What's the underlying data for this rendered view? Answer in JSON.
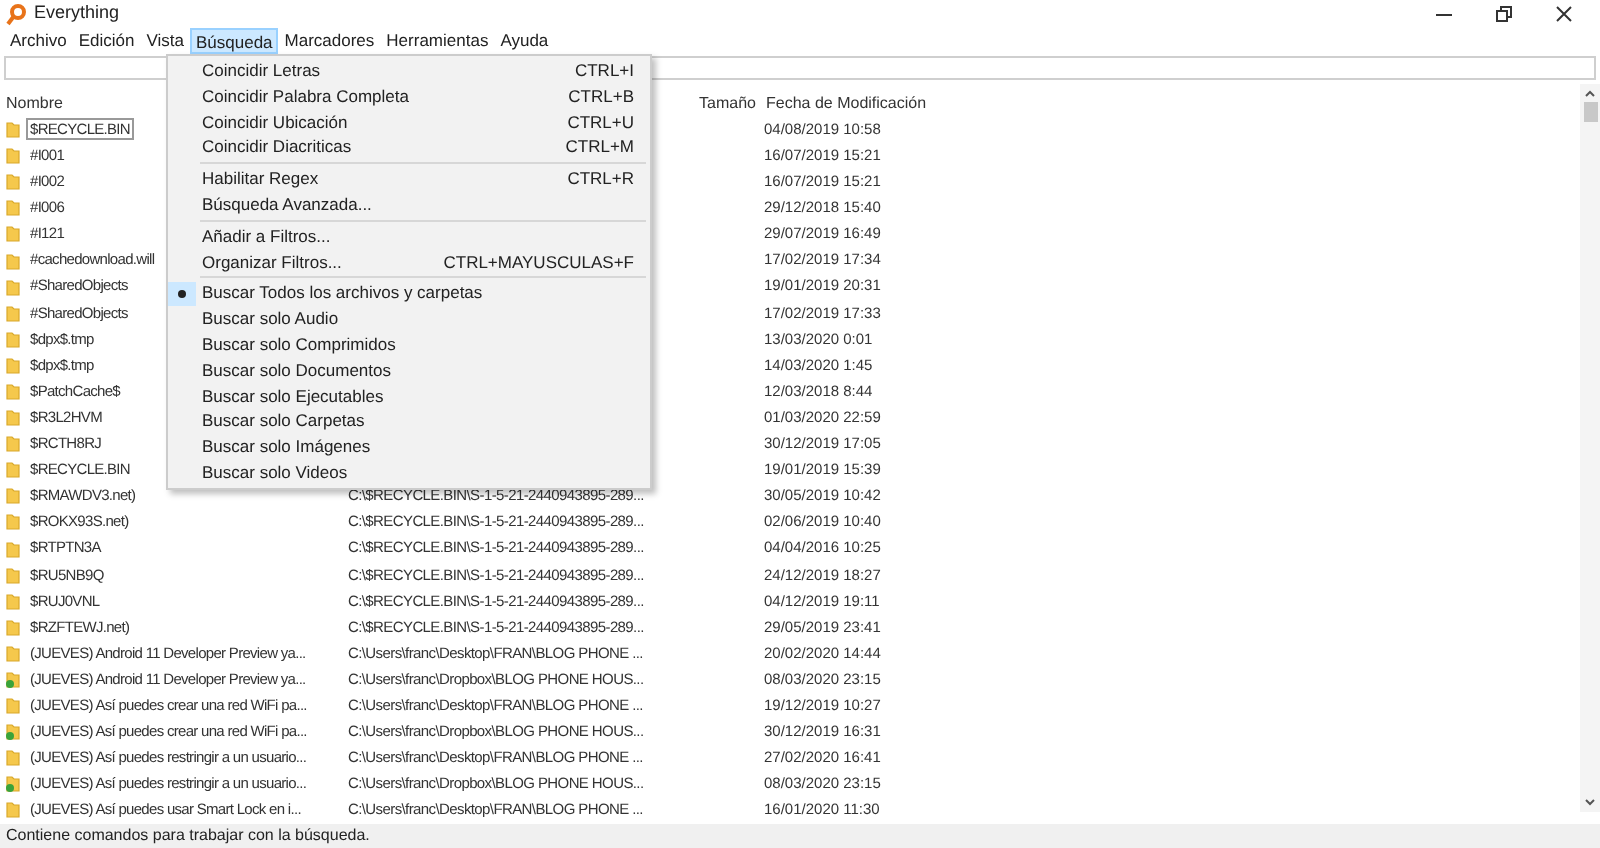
{
  "window": {
    "title": "Everything"
  },
  "menu_bar": [
    {
      "label": "Archivo",
      "selected": false
    },
    {
      "label": "Edición",
      "selected": false
    },
    {
      "label": "Vista",
      "selected": false
    },
    {
      "label": "Búsqueda",
      "selected": true
    },
    {
      "label": "Marcadores",
      "selected": false
    },
    {
      "label": "Herramientas",
      "selected": false
    },
    {
      "label": "Ayuda",
      "selected": false
    }
  ],
  "columns": [
    "Nombre",
    "Tamaño",
    "Fecha de Modificación"
  ],
  "rows": [
    {
      "kind": "folder",
      "name": "$RECYCLE.BIN",
      "date": "04/08/2019 10:58",
      "selected": true
    },
    {
      "kind": "folder",
      "name": "#I001",
      "date": "16/07/2019 15:21",
      "selected": false
    },
    {
      "kind": "folder",
      "name": "#I002",
      "date": "16/07/2019 15:21",
      "selected": false
    },
    {
      "kind": "folder",
      "name": "#I006",
      "date": "29/12/2018 15:40",
      "selected": false
    },
    {
      "kind": "folder",
      "name": "#I121",
      "date": "29/07/2019 16:49",
      "selected": false
    },
    {
      "kind": "folder",
      "name": "#cachedownload.will",
      "date": "17/02/2019 17:34",
      "selected": false
    },
    {
      "kind": "folder",
      "name": "#SharedObjects",
      "date": "19/01/2019 20:31",
      "selected": false
    },
    {
      "kind": "folder",
      "name": "#SharedObjects",
      "date": "17/02/2019 17:33",
      "selected": false
    },
    {
      "kind": "folder",
      "name": "$dpx$.tmp",
      "date": "13/03/2020 0:01",
      "selected": false
    },
    {
      "kind": "folder",
      "name": "$dpx$.tmp",
      "date": "14/03/2020 1:45",
      "selected": false
    },
    {
      "kind": "folder",
      "name": "$PatchCache$",
      "date": "12/03/2018 8:44",
      "selected": false
    },
    {
      "kind": "folder",
      "name": "$R3L2HVM",
      "date": "01/03/2020 22:59",
      "selected": false
    },
    {
      "kind": "folder",
      "name": "$RCTH8RJ",
      "date": "30/12/2019 17:05",
      "selected": false
    },
    {
      "kind": "folder",
      "name": "$RECYCLE.BIN",
      "date": "19/01/2019 15:39",
      "selected": false
    },
    {
      "kind": "folder",
      "name": "$RMAWDV3.net)",
      "path": "C:\\$RECYCLE.BIN\\S-1-5-21-2440943895-289...",
      "date": "30/05/2019 10:42",
      "selected": false
    },
    {
      "kind": "folder",
      "name": "$ROKX93S.net)",
      "path": "C:\\$RECYCLE.BIN\\S-1-5-21-2440943895-289...",
      "date": "02/06/2019 10:40",
      "selected": false
    },
    {
      "kind": "folder",
      "name": "$RTPTN3A",
      "path": "C:\\$RECYCLE.BIN\\S-1-5-21-2440943895-289...",
      "date": "04/04/2016 10:25",
      "selected": false
    },
    {
      "kind": "folder",
      "name": "$RU5NB9Q",
      "path": "C:\\$RECYCLE.BIN\\S-1-5-21-2440943895-289...",
      "date": "24/12/2019 18:27",
      "selected": false
    },
    {
      "kind": "folder",
      "name": "$RUJ0VNL",
      "path": "C:\\$RECYCLE.BIN\\S-1-5-21-2440943895-289...",
      "date": "04/12/2019 19:11",
      "selected": false
    },
    {
      "kind": "folder",
      "name": "$RZFTEWJ.net)",
      "path": "C:\\$RECYCLE.BIN\\S-1-5-21-2440943895-289...",
      "date": "29/05/2019 23:41",
      "selected": false
    },
    {
      "kind": "folder",
      "name": "(JUEVES) Android 11 Developer Preview ya...",
      "path": "C:\\Users\\franc\\Desktop\\FRAN\\BLOG PHONE ...",
      "date": "20/02/2020 14:44",
      "selected": false
    },
    {
      "kind": "synced",
      "name": "(JUEVES) Android 11 Developer Preview ya...",
      "path": "C:\\Users\\franc\\Dropbox\\BLOG PHONE HOUS...",
      "date": "08/03/2020 23:15",
      "selected": false
    },
    {
      "kind": "folder",
      "name": "(JUEVES) Así puedes crear una red WiFi pa...",
      "path": "C:\\Users\\franc\\Desktop\\FRAN\\BLOG PHONE ...",
      "date": "19/12/2019 10:27",
      "selected": false
    },
    {
      "kind": "synced",
      "name": "(JUEVES) Así puedes crear una red WiFi pa...",
      "path": "C:\\Users\\franc\\Dropbox\\BLOG PHONE HOUS...",
      "date": "30/12/2019 16:31",
      "selected": false
    },
    {
      "kind": "folder",
      "name": "(JUEVES) Así puedes restringir a un usuario...",
      "path": "C:\\Users\\franc\\Desktop\\FRAN\\BLOG PHONE ...",
      "date": "27/02/2020 16:41",
      "selected": false
    },
    {
      "kind": "synced",
      "name": "(JUEVES) Así puedes restringir a un usuario...",
      "path": "C:\\Users\\franc\\Dropbox\\BLOG PHONE HOUS...",
      "date": "08/03/2020 23:15",
      "selected": false
    },
    {
      "kind": "folder",
      "name": "(JUEVES) Así puedes usar Smart Lock en i...",
      "path": "C:\\Users\\franc\\Desktop\\FRAN\\BLOG PHONE ...",
      "date": "16/01/2020 11:30",
      "selected": false
    }
  ],
  "search_menu": [
    {
      "kind": "item",
      "label": "Coincidir Letras",
      "shortcut": "CTRL+I"
    },
    {
      "kind": "item",
      "label": "Coincidir Palabra Completa",
      "shortcut": "CTRL+B"
    },
    {
      "kind": "item",
      "label": "Coincidir Ubicación",
      "shortcut": "CTRL+U"
    },
    {
      "kind": "item",
      "label": "Coincidir Diacriticas",
      "shortcut": "CTRL+M"
    },
    {
      "kind": "separator"
    },
    {
      "kind": "item",
      "label": "Habilitar Regex",
      "shortcut": "CTRL+R"
    },
    {
      "kind": "item",
      "label": "Búsqueda Avanzada..."
    },
    {
      "kind": "separator"
    },
    {
      "kind": "item",
      "label": "Añadir a Filtros..."
    },
    {
      "kind": "item",
      "label": "Organizar Filtros...",
      "shortcut": "CTRL+MAYUSCULAS+F"
    },
    {
      "kind": "separator"
    },
    {
      "kind": "radio",
      "label": "Buscar Todos los archivos y carpetas",
      "selected": true
    },
    {
      "kind": "radio",
      "label": "Buscar solo Audio",
      "selected": false
    },
    {
      "kind": "radio",
      "label": "Buscar solo Comprimidos",
      "selected": false
    },
    {
      "kind": "radio",
      "label": "Buscar solo Documentos",
      "selected": false
    },
    {
      "kind": "radio",
      "label": "Buscar solo Ejecutables",
      "selected": false
    },
    {
      "kind": "radio",
      "label": "Buscar solo Carpetas",
      "selected": false
    },
    {
      "kind": "radio",
      "label": "Buscar solo Imágenes",
      "selected": false
    },
    {
      "kind": "radio",
      "label": "Buscar solo Videos",
      "selected": false
    }
  ],
  "status_bar": "Contiene comandos para trabajar con la búsqueda."
}
